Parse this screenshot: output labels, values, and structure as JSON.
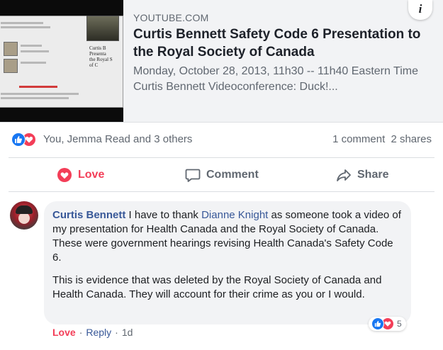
{
  "link_preview": {
    "domain": "YOUTUBE.COM",
    "title": "Curtis Bennett Safety Code 6 Presentation to the Royal Society of Canada",
    "description": "Monday, October 28, 2013, 11h30 -- 11h40 Eastern Time Curtis Bennett Videoconference: Duck!...",
    "info_icon_glyph": "i",
    "thumbnail_slide_text": "Curtis B\nPresenta\nthe Royal S\nof C"
  },
  "reactions": {
    "names": "You, Jemma Read and 3 others",
    "comments": "1 comment",
    "shares": "2 shares",
    "icons": [
      "like-icon",
      "love-icon"
    ]
  },
  "actions": {
    "love": "Love",
    "comment": "Comment",
    "share": "Share"
  },
  "comment": {
    "author": "Curtis Bennett",
    "text_part1": " I have to thank ",
    "mention": "Dianne Knight",
    "text_part2": " as someone took a video of my presentation for Health Canada and the Royal Society of Canada. These were government hearings revising Health Canada's Safety Code 6.",
    "paragraph2": "This is evidence that was deleted by the Royal Society of Canada and Health Canada. They will account for their crime as you or I would.",
    "reaction_count": "5",
    "love_label": "Love",
    "reply_label": "Reply",
    "separator": "·",
    "time": "1d"
  },
  "colors": {
    "like": "#1877f2",
    "love": "#f33e58",
    "link": "#385898",
    "muted": "#606770"
  }
}
